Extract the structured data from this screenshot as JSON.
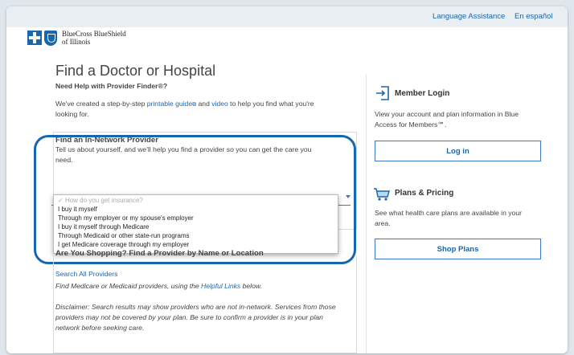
{
  "topbar": {
    "language_assistance": "Language Assistance",
    "espanol": "En español"
  },
  "logo": {
    "line1": "BlueCross BlueShield",
    "line2": "of Illinois"
  },
  "main": {
    "title": "Find a Doctor or Hospital",
    "help_heading": "Need Help with Provider Finder®?",
    "help_text_pre": "We've created a step-by-step ",
    "printable_guide": "printable guide",
    "help_text_and": " and ",
    "video": "video",
    "help_text_post": " to help you find what you're",
    "help_text_line2": "looking for.",
    "in_network": {
      "heading": "Find an In-Network Provider",
      "desc_line1": "Tell us about yourself, and we'll help you find a provider so you can get the care you",
      "desc_line2": "need.",
      "select_placeholder": "How do you get insurance?",
      "options": [
        "I buy it myself",
        "Through my employer or my spouse's employer",
        "I buy it myself through Medicare",
        "Through Medicaid or other state-run programs",
        "I get Medicare coverage through my employer"
      ]
    },
    "shopping_heading": "Are You Shopping? Find a Provider by Name or Location",
    "search_all": "Search All Providers",
    "medicare_text_pre": "Find Medicare or Medicaid providers, using the ",
    "helpful_links": "Helpful Links",
    "medicare_text_post": " below.",
    "disclaimer_line1": "Disclaimer: Search results may show providers who are not in-network. Services from those",
    "disclaimer_line2": "providers may not be covered by your plan. Be sure to confirm a provider is in your plan",
    "disclaimer_line3": "network before seeking care."
  },
  "sidebar": {
    "login": {
      "heading": "Member Login",
      "text_line1": "View your account and plan information in Blue",
      "text_line2": "Access for Members℠.",
      "button": "Log in"
    },
    "plans": {
      "heading": "Plans & Pricing",
      "text_line1": "See what health care plans are available in your",
      "text_line2": "area.",
      "button": "Shop Plans"
    }
  },
  "colors": {
    "brand_blue": "#1a67b0",
    "highlight": "#1468b3"
  }
}
